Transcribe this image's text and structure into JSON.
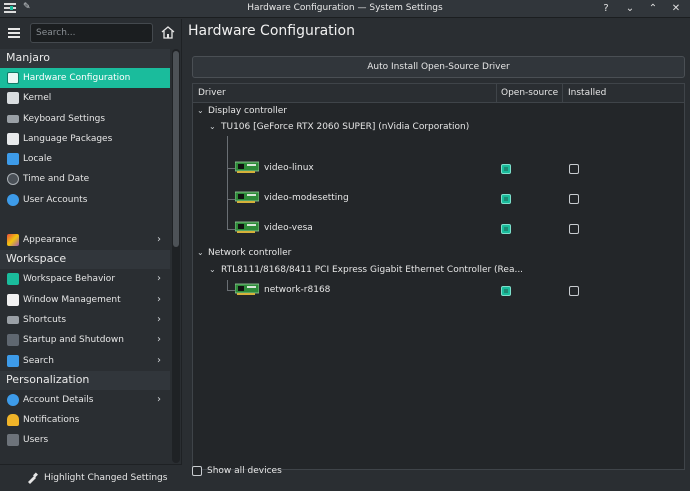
{
  "window": {
    "title": "Hardware Configuration — System Settings",
    "buttons": [
      "?",
      "⌄",
      "⌃",
      "✕"
    ]
  },
  "sidebar": {
    "search_placeholder": "Search...",
    "sections": [
      {
        "title": "Manjaro",
        "items": [
          {
            "label": "Hardware Configuration",
            "icon": "hardware-icon",
            "active": true
          },
          {
            "label": "Kernel",
            "icon": "kernel-icon"
          },
          {
            "label": "Keyboard Settings",
            "icon": "keyboard-icon"
          },
          {
            "label": "Language Packages",
            "icon": "language-icon"
          },
          {
            "label": "Locale",
            "icon": "locale-icon"
          },
          {
            "label": "Time and Date",
            "icon": "clock-icon"
          },
          {
            "label": "User Accounts",
            "icon": "user-icon"
          }
        ]
      },
      {
        "items": [
          {
            "label": "Appearance",
            "icon": "appearance-icon",
            "chevron": true
          }
        ]
      },
      {
        "title": "Workspace",
        "items": [
          {
            "label": "Workspace Behavior",
            "icon": "workspace-icon",
            "chevron": true
          },
          {
            "label": "Window Management",
            "icon": "window-icon",
            "chevron": true
          },
          {
            "label": "Shortcuts",
            "icon": "shortcuts-icon",
            "chevron": true
          },
          {
            "label": "Startup and Shutdown",
            "icon": "startup-icon",
            "chevron": true
          },
          {
            "label": "Search",
            "icon": "search-icon",
            "chevron": true
          }
        ]
      },
      {
        "title": "Personalization",
        "items": [
          {
            "label": "Account Details",
            "icon": "account-icon",
            "chevron": true
          },
          {
            "label": "Notifications",
            "icon": "bell-icon"
          },
          {
            "label": "Users",
            "icon": "users-icon"
          }
        ]
      }
    ],
    "footer_label": "Highlight Changed Settings"
  },
  "main": {
    "title": "Hardware Configuration",
    "auto_install_label": "Auto Install Open-Source Driver",
    "columns": [
      "Driver",
      "Open-source",
      "Installed"
    ],
    "groups": [
      {
        "name": "Display controller",
        "device": "TU106 [GeForce RTX 2060 SUPER] (nVidia Corporation)",
        "drivers": [
          {
            "name": "video-linux",
            "open_source": true,
            "installed": false
          },
          {
            "name": "video-modesetting",
            "open_source": true,
            "installed": false
          },
          {
            "name": "video-vesa",
            "open_source": true,
            "installed": false
          }
        ]
      },
      {
        "name": "Network controller",
        "device": "RTL8111/8168/8411 PCI Express Gigabit Ethernet Controller (Rea...",
        "drivers": [
          {
            "name": "network-r8168",
            "open_source": true,
            "installed": false
          }
        ]
      }
    ],
    "show_all_label": "Show all devices",
    "show_all_checked": false
  },
  "colors": {
    "accent": "#1abc9c",
    "background": "#2a2e32",
    "view_background": "#232629"
  }
}
